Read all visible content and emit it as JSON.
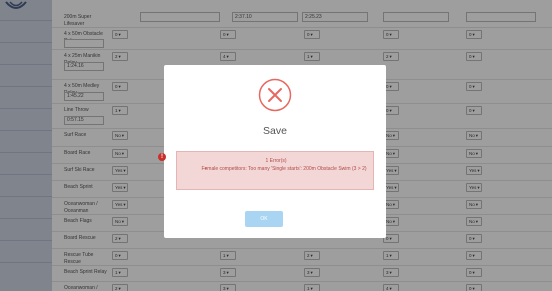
{
  "rows": [
    {
      "label": "200m Super Lifesaver",
      "kind": "top",
      "times": [
        "2:37.10",
        "2:25.23"
      ]
    },
    {
      "label": "4 x 50m Obstacle Relay",
      "kind": "relay",
      "values": [
        "0",
        "0",
        "0",
        "0",
        "0"
      ]
    },
    {
      "label": "4 x 25m Manikin Relay",
      "kind": "relay-time",
      "time": "1:24.16",
      "values": [
        "2",
        "4",
        "1",
        "2",
        "0"
      ]
    },
    {
      "label": "4 x 50m Medley Relay",
      "kind": "relay-time",
      "time": "1:45.22",
      "values": [
        "0",
        "0",
        "0",
        "0",
        "0"
      ]
    },
    {
      "label": "Line Throw",
      "kind": "relay-time",
      "time": "0:57.15",
      "values": [
        "1",
        "",
        "",
        "0",
        "0"
      ]
    },
    {
      "label": "Surf Race",
      "kind": "yesno",
      "values": [
        "No",
        "",
        "",
        "No",
        "No"
      ]
    },
    {
      "label": "Board Race",
      "kind": "yesno",
      "values": [
        "No",
        "",
        "",
        "No",
        "No"
      ]
    },
    {
      "label": "Surf Ski Race",
      "kind": "yesno",
      "values": [
        "Yes",
        "",
        "",
        "Yes",
        "Yes"
      ]
    },
    {
      "label": "Beach Sprint",
      "kind": "yesno",
      "values": [
        "Yes",
        "",
        "",
        "Yes",
        "Yes"
      ]
    },
    {
      "label": "Oceanwoman / Oceanman",
      "kind": "yesno",
      "values": [
        "Yes",
        "",
        "",
        "No",
        "No"
      ]
    },
    {
      "label": "Beach Flags",
      "kind": "yesno",
      "values": [
        "No",
        "",
        "",
        "No",
        "No"
      ]
    },
    {
      "label": "Board Rescue",
      "kind": "relay",
      "values": [
        "2",
        "",
        "",
        "0",
        "0"
      ]
    },
    {
      "label": "Rescue Tube Rescue",
      "kind": "relay",
      "values": [
        "0",
        "1",
        "2",
        "1",
        "0"
      ]
    },
    {
      "label": "Beach Sprint Relay",
      "kind": "relay",
      "values": [
        "1",
        "3",
        "3",
        "3",
        "0"
      ]
    },
    {
      "label": "Oceanwoman / Oceanman Relay",
      "kind": "relay",
      "values": [
        "2",
        "3",
        "1",
        "4",
        "0"
      ]
    }
  ],
  "modal": {
    "title": "Save",
    "error_count": "1 Error(s)",
    "error_message": "Female competitors: Too many 'Single starts': 200m Obstacle Swim (3 > 2)",
    "bullet": "•",
    "alert_icon": "!",
    "ok_label": "OK"
  },
  "colors": {
    "error_red": "#e8685f",
    "alert_bg": "#f3d6d6",
    "ok_button": "#a9d5f3"
  }
}
